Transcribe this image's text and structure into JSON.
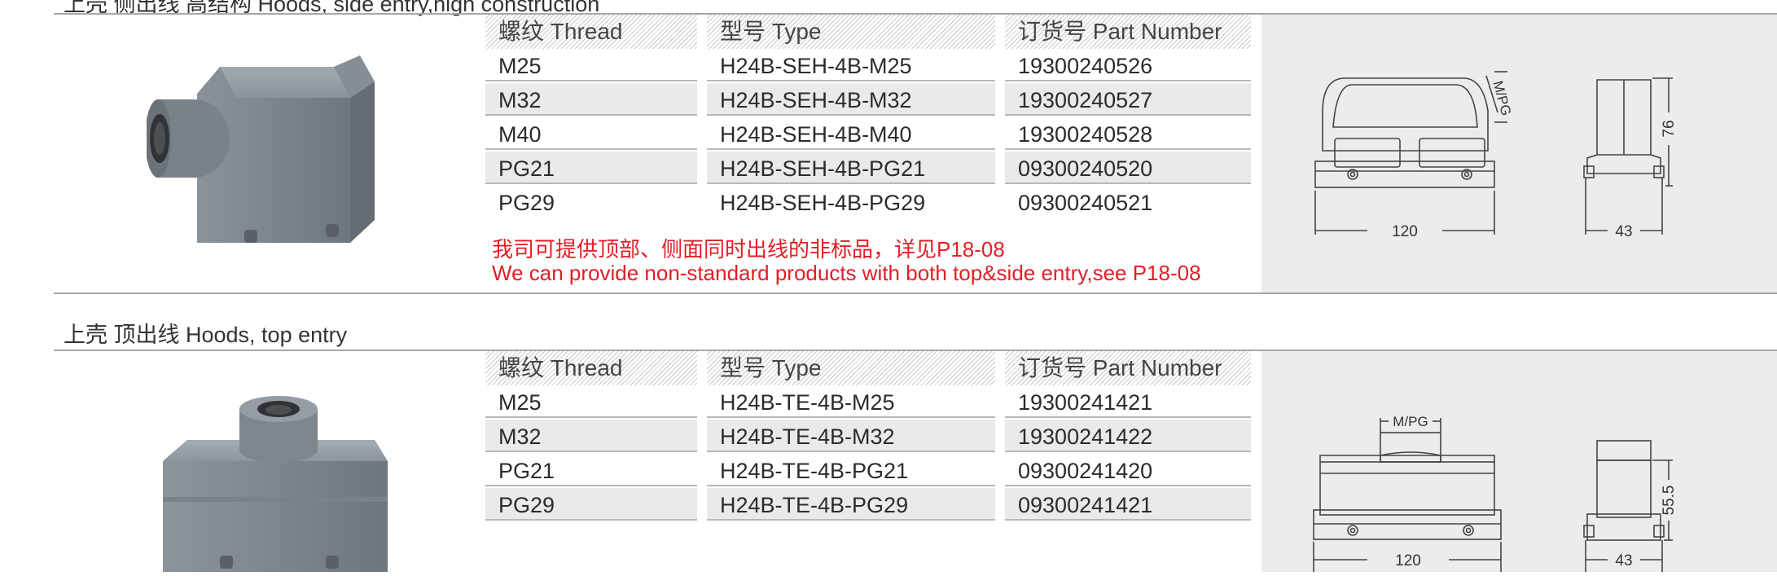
{
  "section1": {
    "title": "上壳 侧出线 高结构 Hoods, side entry,high construction",
    "columns": {
      "thread": "螺纹 Thread",
      "type": "型号 Type",
      "part_number": "订货号 Part Number"
    },
    "rows": [
      {
        "thread": "M25",
        "type": "H24B-SEH-4B-M25",
        "part_number": "19300240526"
      },
      {
        "thread": "M32",
        "type": "H24B-SEH-4B-M32",
        "part_number": "19300240527"
      },
      {
        "thread": "M40",
        "type": "H24B-SEH-4B-M40",
        "part_number": "19300240528"
      },
      {
        "thread": "PG21",
        "type": "H24B-SEH-4B-PG21",
        "part_number": "09300240520"
      },
      {
        "thread": "PG29",
        "type": "H24B-SEH-4B-PG29",
        "part_number": "09300240521"
      }
    ],
    "note_cn": "我司可提供顶部、侧面同时出线的非标品，详见P18-08",
    "note_en": "We can provide non-standard products with both top&side entry,see P18-08",
    "drawing": {
      "dim_width": "120",
      "dim_depth": "43",
      "dim_height": "76",
      "entry_label": "M/PG"
    }
  },
  "section2": {
    "title": "上壳 顶出线  Hoods, top entry",
    "columns": {
      "thread": "螺纹 Thread",
      "type": "型号 Type",
      "part_number": "订货号 Part Number"
    },
    "rows": [
      {
        "thread": "M25",
        "type": "H24B-TE-4B-M25",
        "part_number": "19300241421"
      },
      {
        "thread": "M32",
        "type": "H24B-TE-4B-M32",
        "part_number": "19300241422"
      },
      {
        "thread": "PG21",
        "type": "H24B-TE-4B-PG21",
        "part_number": "09300241420"
      },
      {
        "thread": "PG29",
        "type": "H24B-TE-4B-PG29",
        "part_number": "09300241421"
      }
    ],
    "drawing": {
      "dim_width": "120",
      "dim_depth": "43",
      "dim_height": "55.5",
      "entry_label": "M/PG"
    }
  },
  "colors": {
    "note_red": "#e21e26",
    "rule_gray": "#a8a8a8",
    "panel_gray": "#ececec",
    "hood_gray": "#7e858c"
  }
}
